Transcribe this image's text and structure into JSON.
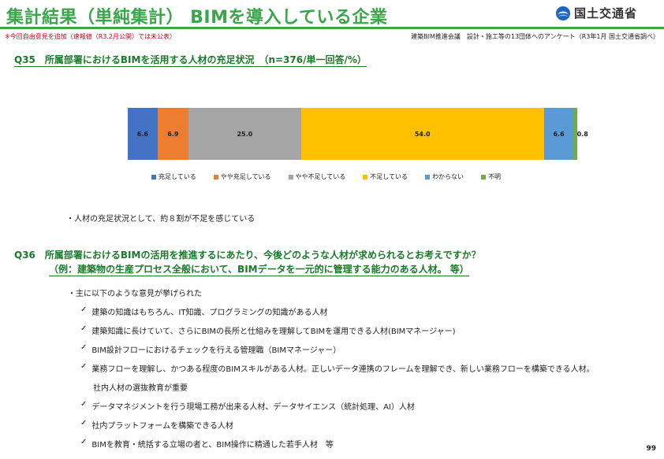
{
  "header": {
    "title": "集計結果（単純集計） BIMを導入している企業",
    "logo_text": "国土交通省",
    "note": "※今回自由意見を追加（速報値（R3.2月公開）では未公表）",
    "source": "建築BIM推進会議　設計・施工等の13団体へのアンケート（R3年1月 国土交通省調べ）"
  },
  "q35": {
    "title": "Q35　所属部署におけるBIMを活用する人材の充足状況　（n=376/単一回答/%）",
    "bullet": "・人材の充足状況として、約８割が不足を感じている"
  },
  "chart_data": {
    "type": "bar",
    "orientation": "horizontal-stacked",
    "categories": [
      "充足している",
      "やや充足している",
      "やや不足している",
      "不足している",
      "わからない",
      "不明"
    ],
    "values": [
      6.6,
      6.9,
      25.0,
      54.0,
      6.6,
      0.8
    ],
    "labels": [
      "6.6",
      "6.9",
      "25.0",
      "54.0",
      "6.6",
      "0.8"
    ],
    "colors": [
      "#4472c4",
      "#ed7d31",
      "#a5a5a5",
      "#ffc000",
      "#5b9bd5",
      "#70ad47"
    ],
    "xlim": [
      0,
      100
    ],
    "legend_position": "bottom"
  },
  "q36": {
    "title_line1": "Q36　所属部署におけるBIMの活用を推進するにあたり、今後どのような人材が求められるとお考えですか？",
    "title_line2": "（例：建築物の生産プロセス全般において、BIMデータを一元的に管理する能力のある人材。 等）",
    "intro": "・主に以下のような意見が挙げられた",
    "check": "✓",
    "items": [
      "建築の知識はもちろん、IT知識、プログラミングの知識がある人材",
      "建築知識に長けていて、さらにBIMの長所と仕組みを理解してBIMを運用できる人材(BIMマネージャー)",
      "BIM設計フローにおけるチェックを行える管理職（BIMマネージャー）",
      "業務フローを理解し、かつある程度のBIMスキルがある人材。正しいデータ連携のフレームを理解でき、新しい業務フローを構築できる人材。",
      "データマネジメントを行う現場工務が出来る人材、データサイエンス（統計処理、AI）人材",
      "社内プラットフォームを構築できる人材",
      "BIMを教育・統括する立場の者と、BIM操作に精通した若手人材　等"
    ],
    "item4_cont": "社内人材の選抜教育が重要"
  },
  "page_number": "99"
}
